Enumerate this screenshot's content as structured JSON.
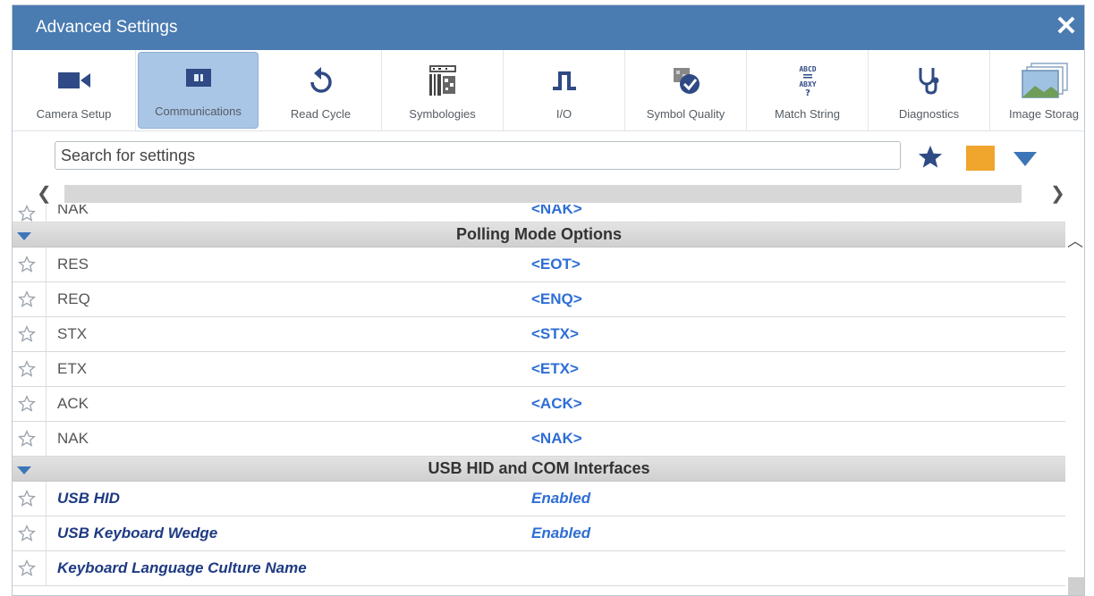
{
  "window": {
    "title": "Advanced Settings",
    "close_icon": "close-icon"
  },
  "toolbar": [
    {
      "label": "Camera Setup",
      "icon": "camera-icon"
    },
    {
      "label": "Communications",
      "icon": "communications-icon",
      "active": true
    },
    {
      "label": "Read Cycle",
      "icon": "refresh-icon"
    },
    {
      "label": "Symbologies",
      "icon": "barcode-icon"
    },
    {
      "label": "I/O",
      "icon": "pulse-icon"
    },
    {
      "label": "Symbol Quality",
      "icon": "quality-badge-icon"
    },
    {
      "label": "Match String",
      "icon": "match-string-icon"
    },
    {
      "label": "Diagnostics",
      "icon": "stethoscope-icon"
    },
    {
      "label": "Image Storag",
      "icon": "image-storage-icon"
    }
  ],
  "search": {
    "placeholder": "Search for settings",
    "value": ""
  },
  "colors": {
    "titlebar": "#4a7bb1",
    "accent_value": "#2e6ed5",
    "favorite_square": "#f0a52c",
    "group_triangle": "#3d76b8"
  },
  "rows": {
    "top_partial": {
      "name": "NAK",
      "value": "<NAK>"
    },
    "group1": {
      "title": "Polling Mode Options"
    },
    "polling": [
      {
        "name": "RES",
        "value": "<EOT>"
      },
      {
        "name": "REQ",
        "value": "<ENQ>"
      },
      {
        "name": "STX",
        "value": "<STX>"
      },
      {
        "name": "ETX",
        "value": "<ETX>"
      },
      {
        "name": "ACK",
        "value": "<ACK>"
      },
      {
        "name": "NAK",
        "value": "<NAK>"
      }
    ],
    "group2": {
      "title": "USB HID and COM Interfaces"
    },
    "usb": [
      {
        "name": "USB HID",
        "value": "Enabled"
      },
      {
        "name": "USB Keyboard Wedge",
        "value": "Enabled"
      },
      {
        "name": "Keyboard Language Culture Name",
        "value": ""
      }
    ]
  }
}
